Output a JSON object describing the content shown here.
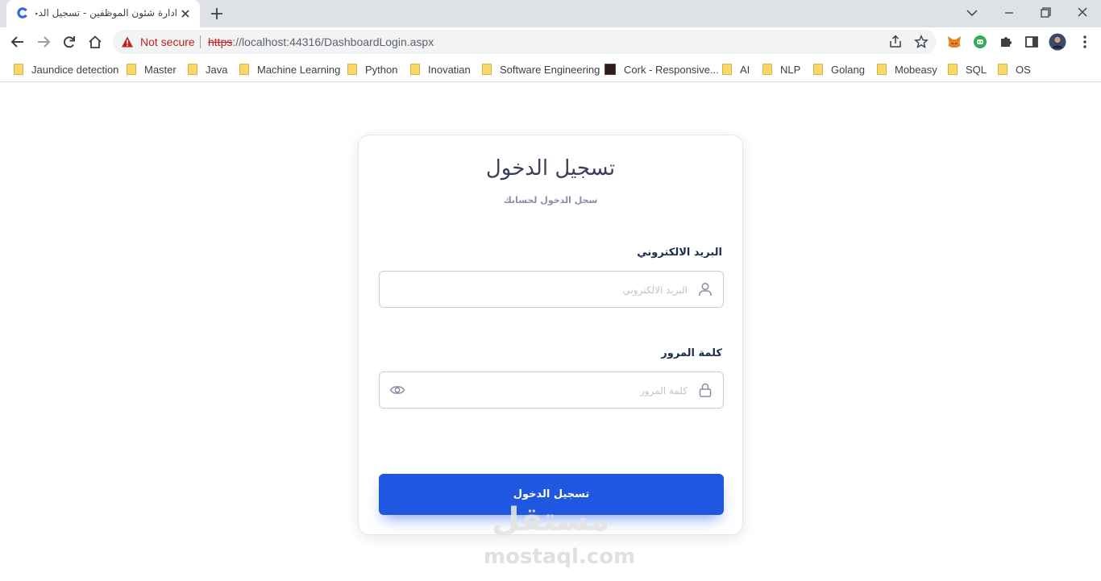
{
  "browser": {
    "tab_title": "ادارة شئون الموظفين - تسجيل الدخول",
    "not_secure_label": "Not secure",
    "url_scheme": "https",
    "url_rest": "://localhost:44316/DashboardLogin.aspx",
    "bookmarks": [
      {
        "label": "Jaundice detection",
        "type": "folder"
      },
      {
        "label": "Master",
        "type": "folder"
      },
      {
        "label": "Java",
        "type": "folder"
      },
      {
        "label": "Machine Learning",
        "type": "folder"
      },
      {
        "label": "Python",
        "type": "folder"
      },
      {
        "label": "Inovatian",
        "type": "folder"
      },
      {
        "label": "Software Engineering",
        "type": "folder"
      },
      {
        "label": "Cork - Responsive...",
        "type": "page"
      },
      {
        "label": "AI",
        "type": "folder"
      },
      {
        "label": "NLP",
        "type": "folder"
      },
      {
        "label": "Golang",
        "type": "folder"
      },
      {
        "label": "Mobeasy",
        "type": "folder"
      },
      {
        "label": "SQL",
        "type": "folder"
      },
      {
        "label": "OS",
        "type": "folder"
      }
    ]
  },
  "login": {
    "title": "تسجيل الدخول",
    "subtitle": "سجل الدخول لحسابك",
    "email_label": "البريد الالكتروني",
    "email_placeholder": "البريد الالكتروني",
    "password_label": "كلمة المرور",
    "password_placeholder": "كلمة المرور",
    "submit_label": "تسجيل الدخول"
  },
  "watermark": {
    "arabic": "مستقل",
    "latin": "mostaql.com"
  },
  "colors": {
    "primary": "#1f57e0",
    "title": "#3b3f5c",
    "label": "#1b2e4b",
    "tabbar": "#dee1e6",
    "warning": "#c5221f"
  },
  "icons": {
    "email_field": "user-icon",
    "password_field": "lock-icon",
    "password_toggle": "eye-icon"
  }
}
